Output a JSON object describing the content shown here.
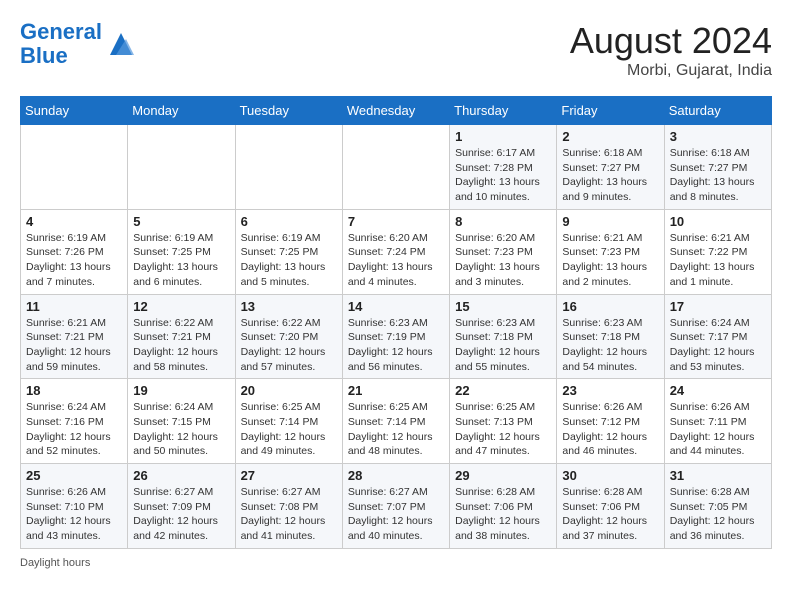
{
  "header": {
    "logo_line1": "General",
    "logo_line2": "Blue",
    "month_year": "August 2024",
    "location": "Morbi, Gujarat, India"
  },
  "days_of_week": [
    "Sunday",
    "Monday",
    "Tuesday",
    "Wednesday",
    "Thursday",
    "Friday",
    "Saturday"
  ],
  "weeks": [
    [
      {
        "day": "",
        "info": ""
      },
      {
        "day": "",
        "info": ""
      },
      {
        "day": "",
        "info": ""
      },
      {
        "day": "",
        "info": ""
      },
      {
        "day": "1",
        "info": "Sunrise: 6:17 AM\nSunset: 7:28 PM\nDaylight: 13 hours and 10 minutes."
      },
      {
        "day": "2",
        "info": "Sunrise: 6:18 AM\nSunset: 7:27 PM\nDaylight: 13 hours and 9 minutes."
      },
      {
        "day": "3",
        "info": "Sunrise: 6:18 AM\nSunset: 7:27 PM\nDaylight: 13 hours and 8 minutes."
      }
    ],
    [
      {
        "day": "4",
        "info": "Sunrise: 6:19 AM\nSunset: 7:26 PM\nDaylight: 13 hours and 7 minutes."
      },
      {
        "day": "5",
        "info": "Sunrise: 6:19 AM\nSunset: 7:25 PM\nDaylight: 13 hours and 6 minutes."
      },
      {
        "day": "6",
        "info": "Sunrise: 6:19 AM\nSunset: 7:25 PM\nDaylight: 13 hours and 5 minutes."
      },
      {
        "day": "7",
        "info": "Sunrise: 6:20 AM\nSunset: 7:24 PM\nDaylight: 13 hours and 4 minutes."
      },
      {
        "day": "8",
        "info": "Sunrise: 6:20 AM\nSunset: 7:23 PM\nDaylight: 13 hours and 3 minutes."
      },
      {
        "day": "9",
        "info": "Sunrise: 6:21 AM\nSunset: 7:23 PM\nDaylight: 13 hours and 2 minutes."
      },
      {
        "day": "10",
        "info": "Sunrise: 6:21 AM\nSunset: 7:22 PM\nDaylight: 13 hours and 1 minute."
      }
    ],
    [
      {
        "day": "11",
        "info": "Sunrise: 6:21 AM\nSunset: 7:21 PM\nDaylight: 12 hours and 59 minutes."
      },
      {
        "day": "12",
        "info": "Sunrise: 6:22 AM\nSunset: 7:21 PM\nDaylight: 12 hours and 58 minutes."
      },
      {
        "day": "13",
        "info": "Sunrise: 6:22 AM\nSunset: 7:20 PM\nDaylight: 12 hours and 57 minutes."
      },
      {
        "day": "14",
        "info": "Sunrise: 6:23 AM\nSunset: 7:19 PM\nDaylight: 12 hours and 56 minutes."
      },
      {
        "day": "15",
        "info": "Sunrise: 6:23 AM\nSunset: 7:18 PM\nDaylight: 12 hours and 55 minutes."
      },
      {
        "day": "16",
        "info": "Sunrise: 6:23 AM\nSunset: 7:18 PM\nDaylight: 12 hours and 54 minutes."
      },
      {
        "day": "17",
        "info": "Sunrise: 6:24 AM\nSunset: 7:17 PM\nDaylight: 12 hours and 53 minutes."
      }
    ],
    [
      {
        "day": "18",
        "info": "Sunrise: 6:24 AM\nSunset: 7:16 PM\nDaylight: 12 hours and 52 minutes."
      },
      {
        "day": "19",
        "info": "Sunrise: 6:24 AM\nSunset: 7:15 PM\nDaylight: 12 hours and 50 minutes."
      },
      {
        "day": "20",
        "info": "Sunrise: 6:25 AM\nSunset: 7:14 PM\nDaylight: 12 hours and 49 minutes."
      },
      {
        "day": "21",
        "info": "Sunrise: 6:25 AM\nSunset: 7:14 PM\nDaylight: 12 hours and 48 minutes."
      },
      {
        "day": "22",
        "info": "Sunrise: 6:25 AM\nSunset: 7:13 PM\nDaylight: 12 hours and 47 minutes."
      },
      {
        "day": "23",
        "info": "Sunrise: 6:26 AM\nSunset: 7:12 PM\nDaylight: 12 hours and 46 minutes."
      },
      {
        "day": "24",
        "info": "Sunrise: 6:26 AM\nSunset: 7:11 PM\nDaylight: 12 hours and 44 minutes."
      }
    ],
    [
      {
        "day": "25",
        "info": "Sunrise: 6:26 AM\nSunset: 7:10 PM\nDaylight: 12 hours and 43 minutes."
      },
      {
        "day": "26",
        "info": "Sunrise: 6:27 AM\nSunset: 7:09 PM\nDaylight: 12 hours and 42 minutes."
      },
      {
        "day": "27",
        "info": "Sunrise: 6:27 AM\nSunset: 7:08 PM\nDaylight: 12 hours and 41 minutes."
      },
      {
        "day": "28",
        "info": "Sunrise: 6:27 AM\nSunset: 7:07 PM\nDaylight: 12 hours and 40 minutes."
      },
      {
        "day": "29",
        "info": "Sunrise: 6:28 AM\nSunset: 7:06 PM\nDaylight: 12 hours and 38 minutes."
      },
      {
        "day": "30",
        "info": "Sunrise: 6:28 AM\nSunset: 7:06 PM\nDaylight: 12 hours and 37 minutes."
      },
      {
        "day": "31",
        "info": "Sunrise: 6:28 AM\nSunset: 7:05 PM\nDaylight: 12 hours and 36 minutes."
      }
    ]
  ],
  "footer": {
    "daylight_hours_label": "Daylight hours"
  }
}
